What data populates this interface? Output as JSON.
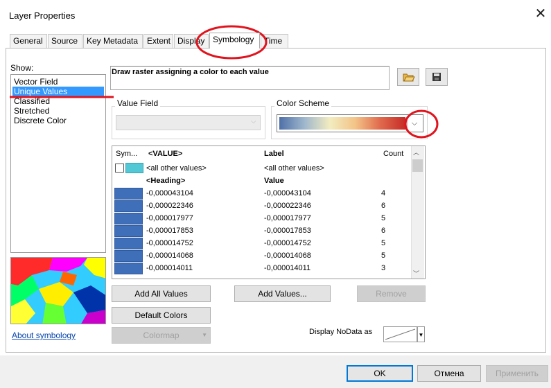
{
  "window": {
    "title": "Layer Properties",
    "close": "✕"
  },
  "tabs": [
    "General",
    "Source",
    "Key Metadata",
    "Extent",
    "Display",
    "Symbology",
    "Time"
  ],
  "show": {
    "label": "Show:",
    "items": [
      "Vector Field",
      "Unique Values",
      "Classified",
      "Stretched",
      "Discrete Color"
    ],
    "selected": "Unique Values"
  },
  "description": "Draw raster assigning a color to each value",
  "value_field": {
    "label": "Value Field",
    "value": ""
  },
  "color_scheme": {
    "label": "Color Scheme",
    "colors": [
      "#4f6fa8",
      "#9fb7cc",
      "#f2ecc0",
      "#f3c488",
      "#e06a4d",
      "#c62b27"
    ]
  },
  "table": {
    "headers": {
      "sym": "Sym...",
      "value": "<VALUE>",
      "label": "Label",
      "count": "Count"
    },
    "other": {
      "value": "<all other values>",
      "label": "<all other values>"
    },
    "heading": {
      "value": "<Heading>",
      "label": "Value"
    },
    "rows": [
      {
        "value": "-0,000043104",
        "label": "-0,000043104",
        "count": "4"
      },
      {
        "value": "-0,000022346",
        "label": "-0,000022346",
        "count": "6"
      },
      {
        "value": "-0,000017977",
        "label": "-0,000017977",
        "count": "5"
      },
      {
        "value": "-0,000017853",
        "label": "-0,000017853",
        "count": "6"
      },
      {
        "value": "-0,000014752",
        "label": "-0,000014752",
        "count": "5"
      },
      {
        "value": "-0,000014068",
        "label": "-0,000014068",
        "count": "5"
      },
      {
        "value": "-0,000014011",
        "label": "-0,000014011",
        "count": "3"
      }
    ]
  },
  "buttons": {
    "add_all": "Add All Values",
    "add": "Add Values...",
    "remove": "Remove",
    "default_colors": "Default Colors",
    "colormap": "Colormap",
    "ok": "OK",
    "cancel": "Отмена",
    "apply": "Применить"
  },
  "link": "About symbology",
  "nodata_label": "Display NoData as",
  "icons": {
    "open": "folder-open-icon",
    "save": "floppy-save-icon"
  },
  "accent": "#0078d7"
}
